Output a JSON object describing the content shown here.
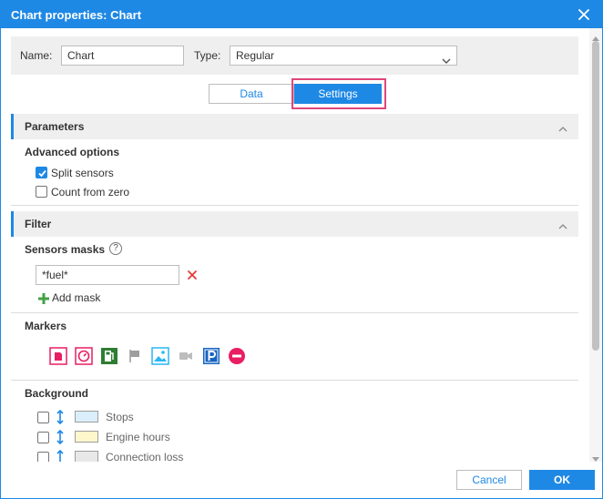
{
  "dialog": {
    "title": "Chart properties: Chart"
  },
  "general": {
    "name_label": "Name:",
    "name_value": "Chart",
    "type_label": "Type:",
    "type_value": "Regular"
  },
  "tabs": [
    {
      "label": "Data",
      "active": false
    },
    {
      "label": "Settings",
      "active": true
    }
  ],
  "parameters": {
    "section_title": "Parameters",
    "advanced_title": "Advanced options",
    "options": [
      {
        "label": "Split sensors",
        "checked": true
      },
      {
        "label": "Count from zero",
        "checked": false
      }
    ]
  },
  "filter": {
    "section_title": "Filter",
    "sensors_masks_title": "Sensors masks",
    "help_glyph": "?",
    "mask_value": "*fuel*",
    "add_mask_label": "Add mask"
  },
  "markers": {
    "title": "Markers",
    "icons": [
      {
        "name": "fuel-filling-marker-icon",
        "color": "#e91e63"
      },
      {
        "name": "speed-marker-icon",
        "color": "#e91e63"
      },
      {
        "name": "fuel-station-marker-icon",
        "color": "#2e7d32"
      },
      {
        "name": "flag-marker-icon",
        "color": "#9e9e9e"
      },
      {
        "name": "image-marker-icon",
        "color": "#29b6f6"
      },
      {
        "name": "video-marker-icon",
        "color": "#9e9e9e"
      },
      {
        "name": "parking-marker-icon",
        "color": "#1565c0"
      },
      {
        "name": "stop-marker-icon",
        "color": "#e91e63"
      }
    ]
  },
  "background": {
    "title": "Background",
    "items": [
      {
        "label": "Stops",
        "checked": false,
        "color": "#dbeefb"
      },
      {
        "label": "Engine hours",
        "checked": false,
        "color": "#fff7cc"
      },
      {
        "label": "Connection loss",
        "checked": false,
        "color": "#e8e8e8"
      }
    ]
  },
  "footer": {
    "cancel_label": "Cancel",
    "ok_label": "OK"
  },
  "colors": {
    "accent": "#1e88e5",
    "highlight": "#e0457b",
    "remove": "#e53935",
    "add": "#43a047"
  }
}
